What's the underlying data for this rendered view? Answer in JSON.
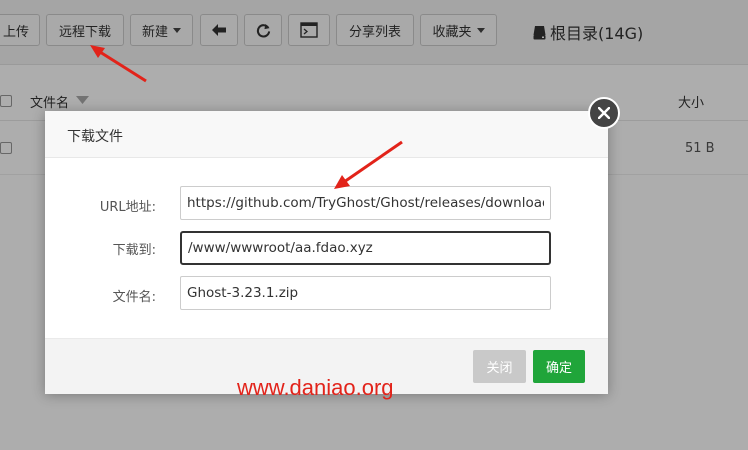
{
  "toolbar": {
    "upload_label": "上传",
    "remote_download_label": "远程下载",
    "new_label": "新建",
    "share_list_label": "分享列表",
    "favorites_label": "收藏夹",
    "disk_label": "根目录(14G)"
  },
  "table": {
    "col_filename": "文件名",
    "col_size": "大小",
    "rows": [
      {
        "size": "51 B"
      }
    ]
  },
  "dialog": {
    "title": "下载文件",
    "url_label": "URL地址:",
    "url_value": "https://github.com/TryGhost/Ghost/releases/download/",
    "dest_label": "下载到:",
    "dest_value": "/www/wwwroot/aa.fdao.xyz",
    "filename_label": "文件名:",
    "filename_value": "Ghost-3.23.1.zip",
    "close_label": "关闭",
    "confirm_label": "确定"
  },
  "watermark": "www.daniao.org",
  "colors": {
    "confirm": "#20a53a",
    "close_disabled": "#c9c9c9",
    "arrow": "#e2231a",
    "watermark": "#e2231a"
  },
  "icons": [
    "back-arrow-icon",
    "refresh-icon",
    "terminal-icon",
    "hdd-icon",
    "close-icon",
    "sort-caret-icon"
  ]
}
